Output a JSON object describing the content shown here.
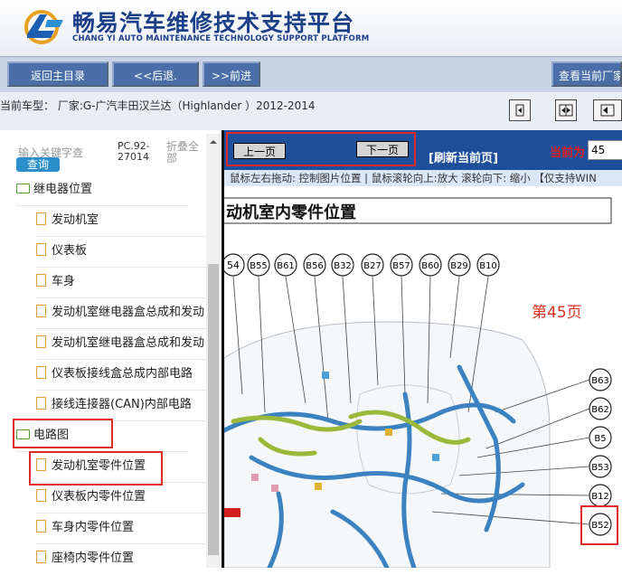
{
  "header": {
    "title": "畅易汽车维修技术支持平台",
    "subtitle": "CHANG YI AUTO MAINTENANCE TECHNOLOGY SUPPORT PLATFORM"
  },
  "toolbar": {
    "home_label": "返回主目录",
    "back_label": "<<后退.",
    "forward_label": ">>前进",
    "current_maker_label": "查看当前厂家"
  },
  "vehicle": {
    "text": "当前车型： 厂家:G-广汽丰田汉兰达（Highlander ）2012-2014"
  },
  "sidebar": {
    "search_placeholder": "输入关键字查",
    "query_label": "查询",
    "pc_code": "PC.92-27014",
    "collapse_label": "折叠全部",
    "items": [
      {
        "label": "继电器位置",
        "type": "folder"
      },
      {
        "label": "发动机室",
        "type": "doc"
      },
      {
        "label": "仪表板",
        "type": "doc"
      },
      {
        "label": "车身",
        "type": "doc"
      },
      {
        "label": "发动机室继电器盒总成和发动",
        "type": "doc"
      },
      {
        "label": "发动机室继电器盒总成和发动",
        "type": "doc"
      },
      {
        "label": "仪表板接线盒总成内部电路",
        "type": "doc"
      },
      {
        "label": "接线连接器(CAN)内部电路",
        "type": "doc"
      },
      {
        "label": "电路图",
        "type": "folder"
      },
      {
        "label": "发动机室零件位置",
        "type": "doc"
      },
      {
        "label": "仪表板内零件位置",
        "type": "doc"
      },
      {
        "label": "车身内零件位置",
        "type": "doc"
      },
      {
        "label": "座椅内零件位置",
        "type": "doc"
      }
    ]
  },
  "viewer": {
    "prev_label": "上一页",
    "next_label": "下一页",
    "refresh_label": "[刷新当前页]",
    "current_page_label": "当前为",
    "current_page_value": "45",
    "hint": "鼠标左右拖动: 控制图片位置 | 鼠标滚轮向上:放大  滚轮向下: 缩小 【仅支持WIN"
  },
  "diagram": {
    "title": "动机室内零件位置",
    "page_label": "第45页",
    "top_connectors": [
      "54",
      "B55",
      "B61",
      "B56",
      "B32",
      "B27",
      "B57",
      "B60",
      "B29",
      "B10"
    ],
    "right_connectors": [
      "B63",
      "B62",
      "B5",
      "B53",
      "B12",
      "B52"
    ]
  },
  "colors": {
    "brand": "#1c3f8a",
    "toolbar_button": "#4a6fa8",
    "viewer_bar": "#1e4f9a",
    "highlight": "#e02a2a",
    "harness_blue": "#3a82c0",
    "harness_green": "#9ab83a"
  }
}
